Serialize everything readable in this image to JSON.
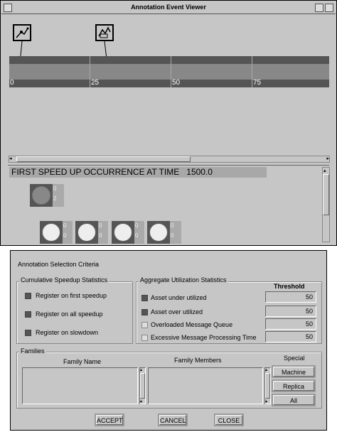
{
  "viewer": {
    "title": "Annotation Event Viewer",
    "ticks": [
      "0",
      "25",
      "50",
      "75"
    ],
    "message": "FIRST SPEED UP OCCURRENCE AT TIME   1500.0",
    "main_counts": [
      "0",
      "2"
    ],
    "small_counts": [
      [
        "0",
        "0"
      ],
      [
        "0",
        "0"
      ],
      [
        "0",
        "0"
      ],
      [
        "0",
        "0"
      ]
    ]
  },
  "criteria": {
    "title": "Annotation Selection Criteria",
    "cumulative": {
      "label": "Cumulative Speedup Statistics",
      "items": [
        "Register on first speedup",
        "Register on all speedup",
        "Register on slowdown"
      ]
    },
    "aggregate": {
      "label": "Aggregate Utilization  Statistics",
      "threshold_label": "Threshold",
      "items": [
        {
          "label": "Asset under utilized",
          "value": "50"
        },
        {
          "label": "Asset over utilized",
          "value": "50"
        },
        {
          "label": "Overloaded Message Queue",
          "value": "50"
        },
        {
          "label": "Excessive Message Processing Time",
          "value": "50"
        }
      ]
    },
    "families": {
      "label": "Families",
      "name_header": "Family Name",
      "members_header": "Family Members",
      "special_header": "Special",
      "special_buttons": [
        "Machine",
        "Replica",
        "All"
      ]
    },
    "buttons": {
      "accept": "ACCEPT",
      "cancel": "CANCEL",
      "close": "CLOSE"
    }
  }
}
